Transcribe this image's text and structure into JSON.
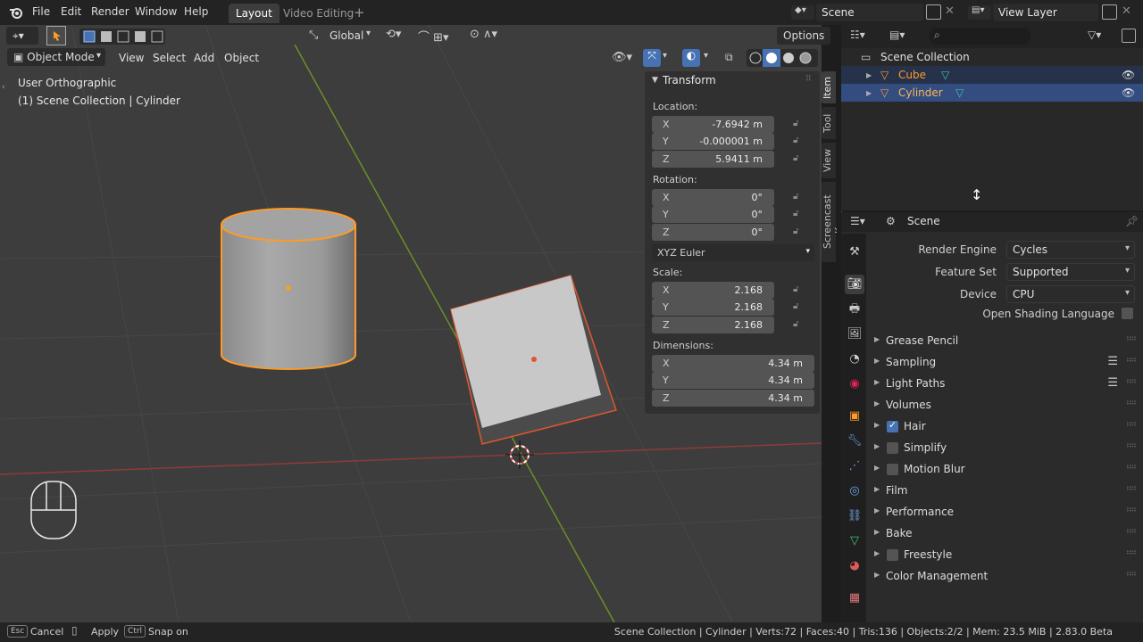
{
  "topbar": {
    "menus": [
      "File",
      "Edit",
      "Render",
      "Window",
      "Help"
    ],
    "workspaces": [
      "Layout",
      "Video Editing"
    ],
    "active_workspace": "Layout",
    "scene_name": "Scene",
    "view_layer": "View Layer"
  },
  "viewport_header": {
    "orientation": "Global",
    "options_label": "Options",
    "mode": "Object Mode",
    "menus": [
      "View",
      "Select",
      "Add",
      "Object"
    ]
  },
  "viewport": {
    "view_label": "User Orthographic",
    "collection_label": "(1) Scene Collection | Cylinder"
  },
  "npanel": {
    "section_title": "Transform",
    "location_label": "Location:",
    "location": [
      {
        "axis": "X",
        "value": "-7.6942 m"
      },
      {
        "axis": "Y",
        "value": "-0.000001 m"
      },
      {
        "axis": "Z",
        "value": "5.9411 m"
      }
    ],
    "rotation_label": "Rotation:",
    "rotation": [
      {
        "axis": "X",
        "value": "0°"
      },
      {
        "axis": "Y",
        "value": "0°"
      },
      {
        "axis": "Z",
        "value": "0°"
      }
    ],
    "rotation_mode": "XYZ Euler",
    "scale_label": "Scale:",
    "scale": [
      {
        "axis": "X",
        "value": "2.168"
      },
      {
        "axis": "Y",
        "value": "2.168"
      },
      {
        "axis": "Z",
        "value": "2.168"
      }
    ],
    "dimensions_label": "Dimensions:",
    "dimensions": [
      {
        "axis": "X",
        "value": "4.34 m"
      },
      {
        "axis": "Y",
        "value": "4.34 m"
      },
      {
        "axis": "Z",
        "value": "4.34 m"
      }
    ],
    "tabs": [
      "Item",
      "Tool",
      "View",
      "Screencast Keys"
    ]
  },
  "outliner": {
    "root": "Scene Collection",
    "items": [
      {
        "name": "Cube"
      },
      {
        "name": "Cylinder"
      }
    ]
  },
  "properties": {
    "context": "Scene",
    "render_engine_label": "Render Engine",
    "render_engine": "Cycles",
    "feature_set_label": "Feature Set",
    "feature_set": "Supported",
    "device_label": "Device",
    "device": "CPU",
    "osl_label": "Open Shading Language",
    "panels": [
      {
        "title": "Grease Pencil"
      },
      {
        "title": "Sampling"
      },
      {
        "title": "Light Paths"
      },
      {
        "title": "Volumes"
      },
      {
        "title": "Hair"
      },
      {
        "title": "Simplify"
      },
      {
        "title": "Motion Blur"
      },
      {
        "title": "Film"
      },
      {
        "title": "Performance"
      },
      {
        "title": "Bake"
      },
      {
        "title": "Freestyle"
      },
      {
        "title": "Color Management"
      }
    ]
  },
  "statusbar": {
    "esc_key": "Esc",
    "cancel": "Cancel",
    "apply": "Apply",
    "ctrl_key": "Ctrl",
    "snap": "Snap on",
    "stats": "Scene Collection | Cylinder | Verts:72 | Faces:40 | Tris:136 | Objects:2/2 | Mem: 23.5 MiB | 2.83.0 Beta"
  },
  "colors": {
    "accent": "#4772b3",
    "selection_outline": "#ff9a27",
    "x_axis": "#a5413a",
    "y_axis": "#6a9a2a"
  }
}
